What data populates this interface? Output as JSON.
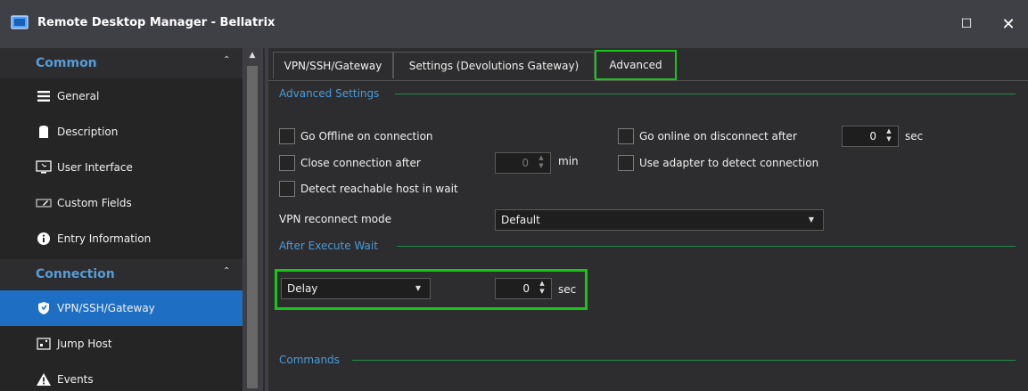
{
  "window": {
    "title": "Remote Desktop Manager - Bellatrix",
    "maximize_glyph": "☐",
    "close_glyph": "✕"
  },
  "sidebar": {
    "scroll_up_glyph": "▲",
    "groups": [
      {
        "label": "Common",
        "chevron": "⌃"
      },
      {
        "label": "Connection",
        "chevron": "⌃"
      }
    ],
    "items": [
      {
        "label": "General",
        "icon": "hamburger-icon"
      },
      {
        "label": "Description",
        "icon": "description-icon"
      },
      {
        "label": "User Interface",
        "icon": "monitor-icon"
      },
      {
        "label": "Custom Fields",
        "icon": "tag-icon"
      },
      {
        "label": "Entry Information",
        "icon": "info-icon"
      },
      {
        "label": "VPN/SSH/Gateway",
        "icon": "shield-icon",
        "active": true
      },
      {
        "label": "Jump Host",
        "icon": "jump-host-icon"
      },
      {
        "label": "Events",
        "icon": "warning-icon"
      }
    ]
  },
  "tabs": [
    {
      "label": "VPN/SSH/Gateway"
    },
    {
      "label": "Settings (Devolutions Gateway)"
    },
    {
      "label": "Advanced",
      "active": true
    }
  ],
  "sections": {
    "advanced_settings": "Advanced Settings",
    "after_execute_wait": "After Execute Wait",
    "commands": "Commands"
  },
  "advanced": {
    "go_offline_on_connection": {
      "label": "Go Offline on connection",
      "checked": false
    },
    "close_connection_after": {
      "label": "Close connection after",
      "checked": false,
      "value": "0",
      "unit": "min",
      "disabled": true
    },
    "detect_reachable_host": {
      "label": "Detect reachable host in wait",
      "checked": false
    },
    "go_online_on_disconnect": {
      "label": "Go online on disconnect after",
      "checked": false,
      "value": "0",
      "unit": "sec"
    },
    "use_adapter": {
      "label": "Use adapter to detect connection",
      "checked": false
    },
    "vpn_reconnect_mode": {
      "label": "VPN reconnect mode",
      "value": "Default"
    }
  },
  "after_execute": {
    "mode": "Delay",
    "value": "0",
    "unit": "sec"
  },
  "colors": {
    "highlight": "#19c519",
    "accent": "#1e6fc3",
    "section_header": "#4a9bd8"
  }
}
